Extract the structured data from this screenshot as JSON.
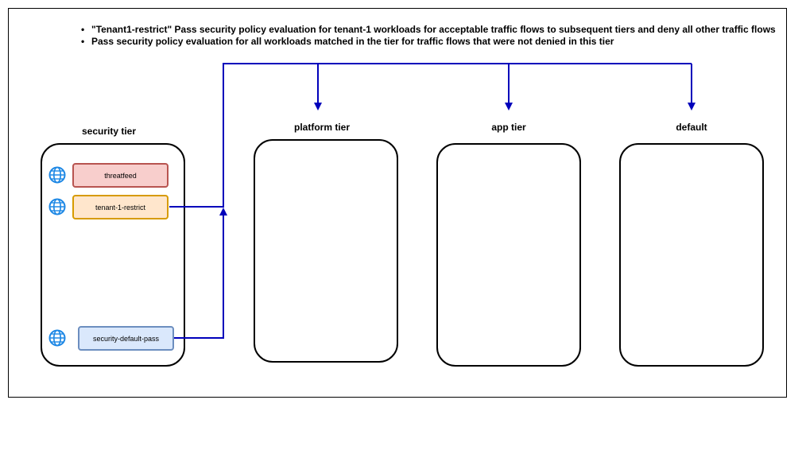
{
  "notes": [
    "\"Tenant1-restrict\" Pass security policy evaluation for tenant-1 workloads for acceptable traffic flows to subsequent tiers and deny all other traffic flows",
    "Pass security policy evaluation for all workloads matched in the tier for traffic flows that were not denied in this tier"
  ],
  "tiers": {
    "security": "security tier",
    "platform": "platform tier",
    "app": "app tier",
    "default": "default"
  },
  "policies": {
    "threatfeed": "threatfeed",
    "tenant_restrict": "tenant-1-restrict",
    "security_default_pass": "security-default-pass"
  },
  "colors": {
    "flow_line": "#0000bb",
    "threatfeed_fill": "#f8cecc",
    "tenant_fill": "#ffe6cc",
    "default_pass_fill": "#dae8fc",
    "globe": "#1e88e5"
  },
  "icons": [
    "globe-icon"
  ]
}
